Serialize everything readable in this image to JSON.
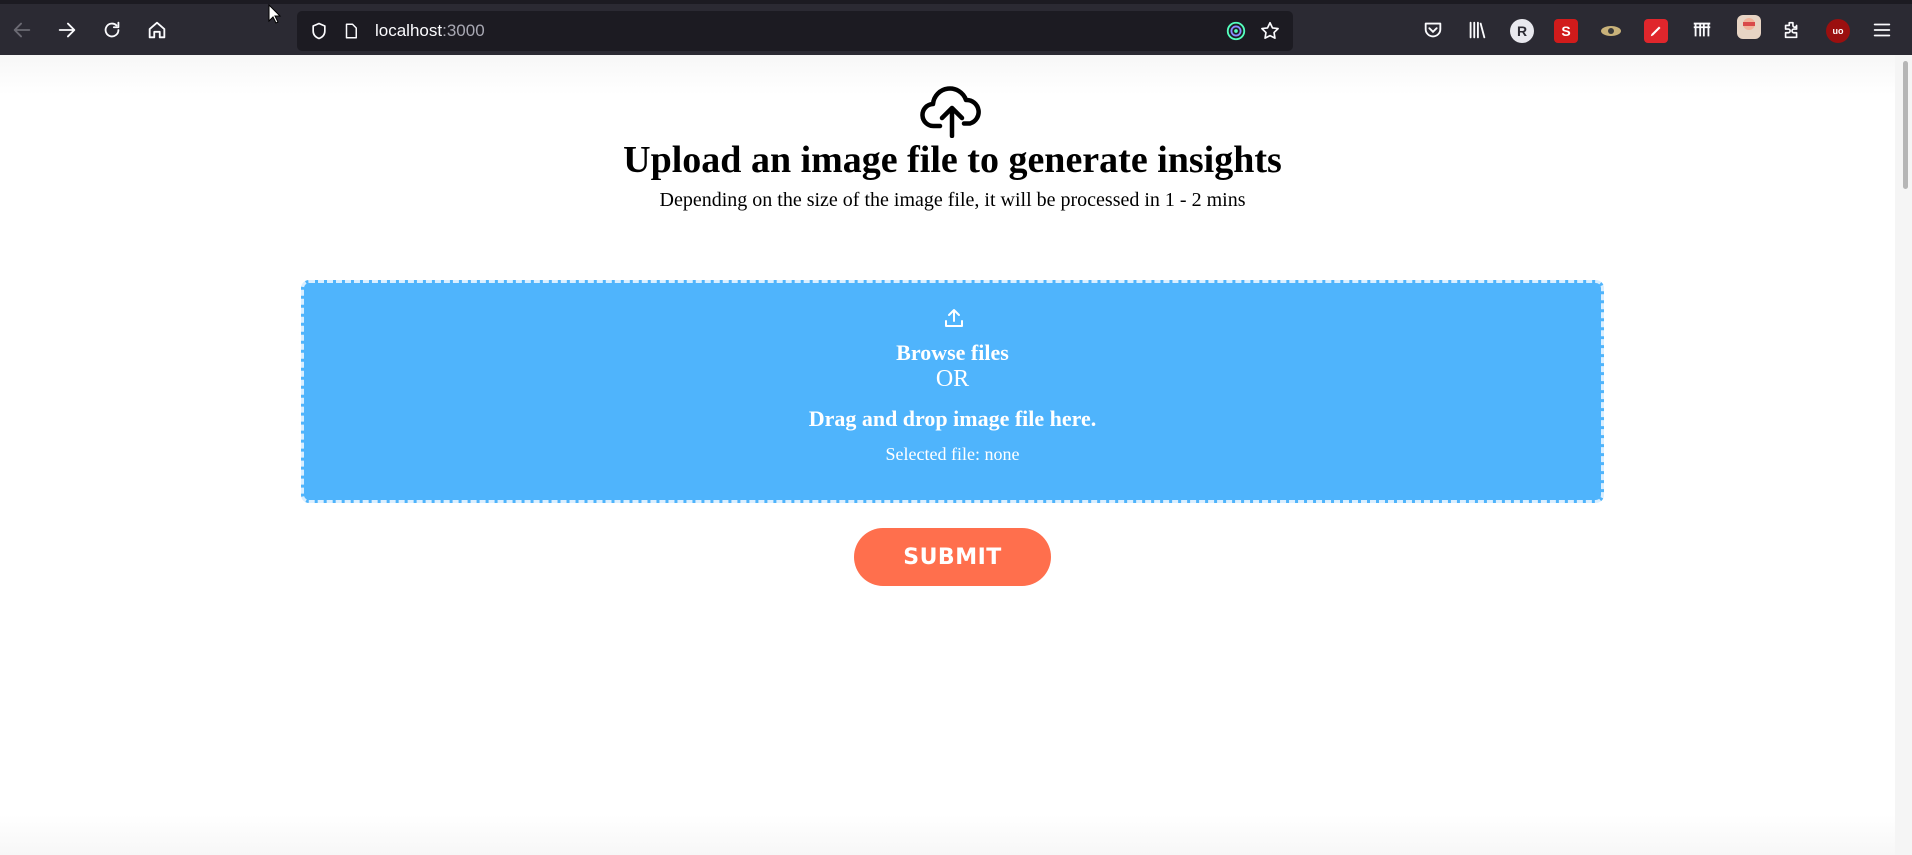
{
  "browser": {
    "url_host": "localhost",
    "url_port": ":3000"
  },
  "page": {
    "title": "Upload an image file to generate insights",
    "subtitle": "Depending on the size of the image file, it will be processed in 1 - 2 mins"
  },
  "dropzone": {
    "browse_label": "Browse files",
    "or_label": "OR",
    "drag_label": "Drag and drop image file here.",
    "selected_file": "Selected file: none"
  },
  "submit_label": "SUBMIT",
  "extensions": {
    "profile_letter": "R",
    "s_ext_letter": "S",
    "ublock_letter": "uo"
  },
  "colors": {
    "dropzone_bg": "#4fb4fc",
    "submit_bg": "#ff6f4d",
    "toolbar_bg": "#2b2a33"
  }
}
